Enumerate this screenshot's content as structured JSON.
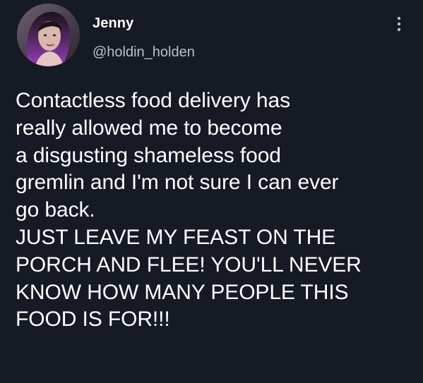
{
  "user": {
    "display_name": "Jenny",
    "handle": "@holdin_holden",
    "avatar_icon": "user-avatar"
  },
  "menu": {
    "icon": "more-vertical-icon"
  },
  "tweet": {
    "text": "Contactless food delivery has\nreally allowed me to become\na disgusting shameless food\ngremlin and I'm not sure I can ever\ngo back.\nJUST LEAVE MY FEAST ON THE\nPORCH AND FLEE! YOU'LL NEVER\nKNOW HOW MANY PEOPLE THIS\nFOOD IS FOR!!!"
  },
  "colors": {
    "background": "#151a24",
    "text_primary": "#ffffff",
    "text_secondary": "#b9c0c8"
  }
}
